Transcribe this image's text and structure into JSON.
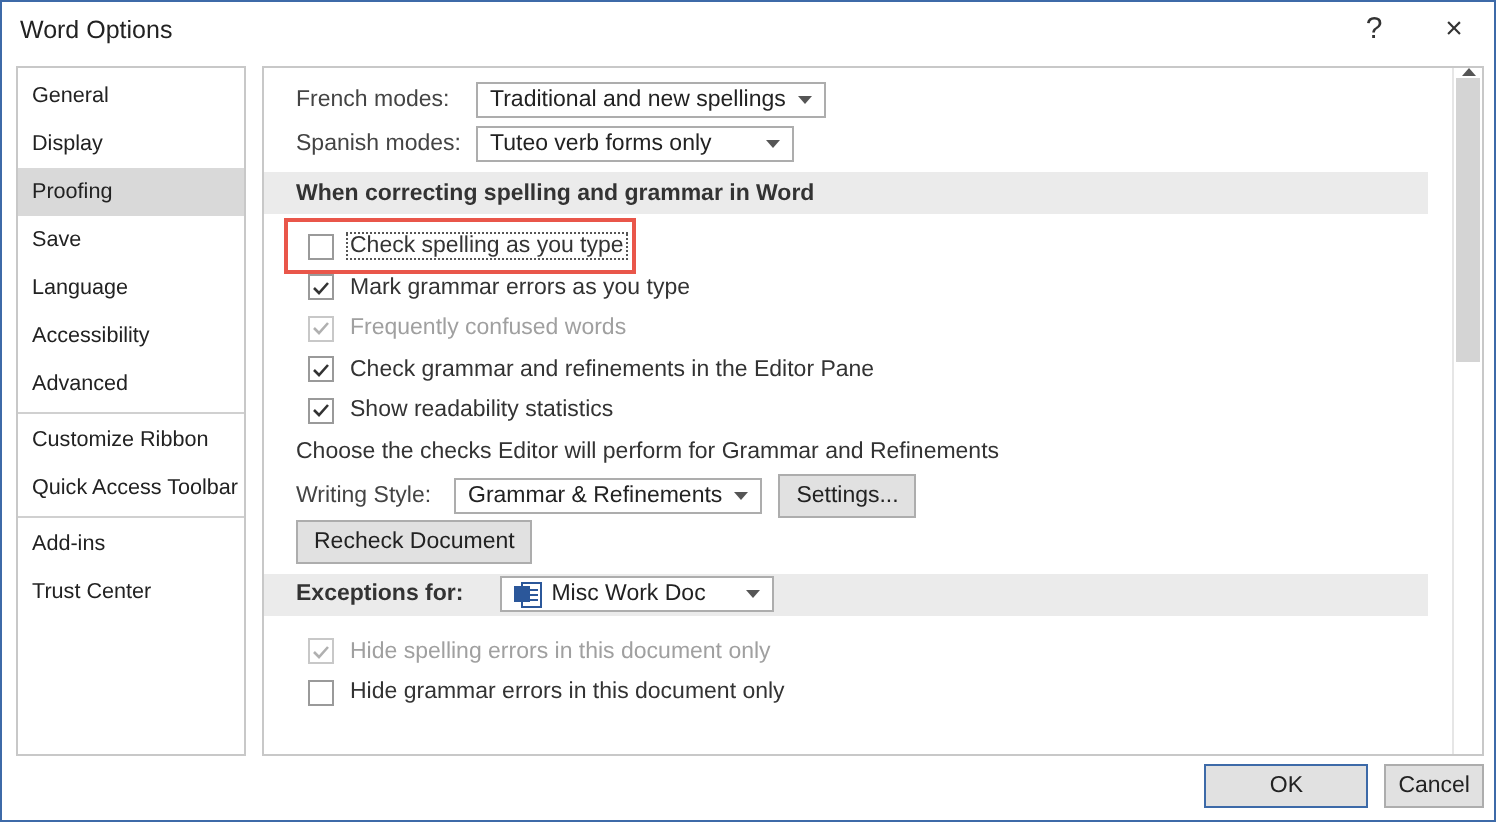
{
  "window": {
    "title": "Word Options",
    "help": "?",
    "close": "×"
  },
  "sidebar": {
    "groups": [
      [
        {
          "label": "General",
          "selected": false
        },
        {
          "label": "Display",
          "selected": false
        },
        {
          "label": "Proofing",
          "selected": true
        },
        {
          "label": "Save",
          "selected": false
        },
        {
          "label": "Language",
          "selected": false
        },
        {
          "label": "Accessibility",
          "selected": false
        },
        {
          "label": "Advanced",
          "selected": false
        }
      ],
      [
        {
          "label": "Customize Ribbon",
          "selected": false
        },
        {
          "label": "Quick Access Toolbar",
          "selected": false
        }
      ],
      [
        {
          "label": "Add-ins",
          "selected": false
        },
        {
          "label": "Trust Center",
          "selected": false
        }
      ]
    ]
  },
  "modes": [
    {
      "label": "French modes:",
      "value": "Traditional and new spellings"
    },
    {
      "label": "Spanish modes:",
      "value": "Tuteo verb forms only"
    }
  ],
  "spelling_section": {
    "heading": "When correcting spelling and grammar in Word",
    "options": [
      {
        "label": "Check spelling as you type",
        "checked": false,
        "disabled": false,
        "highlighted": true,
        "focused": true
      },
      {
        "label": "Mark grammar errors as you type",
        "checked": true,
        "disabled": false,
        "highlighted": false,
        "focused": false
      },
      {
        "label": "Frequently confused words",
        "checked": true,
        "disabled": true,
        "highlighted": false,
        "focused": false
      },
      {
        "label": "Check grammar and refinements in the Editor Pane",
        "checked": true,
        "disabled": false,
        "highlighted": false,
        "focused": false
      },
      {
        "label": "Show readability statistics",
        "checked": true,
        "disabled": false,
        "highlighted": false,
        "focused": false
      }
    ],
    "note": "Choose the checks Editor will perform for Grammar and Refinements",
    "writing_style": {
      "label": "Writing Style:",
      "value": "Grammar & Refinements"
    },
    "settings_button": "Settings...",
    "recheck_button": "Recheck Document"
  },
  "exceptions_section": {
    "label": "Exceptions for:",
    "document": "Misc Work Doc",
    "options": [
      {
        "label": "Hide spelling errors in this document only",
        "checked": true,
        "disabled": true,
        "highlighted": false,
        "focused": false
      },
      {
        "label": "Hide grammar errors in this document only",
        "checked": false,
        "disabled": false,
        "highlighted": false,
        "focused": false
      }
    ]
  },
  "buttons": [
    {
      "label": "OK",
      "default": true
    },
    {
      "label": "Cancel",
      "default": false
    }
  ]
}
